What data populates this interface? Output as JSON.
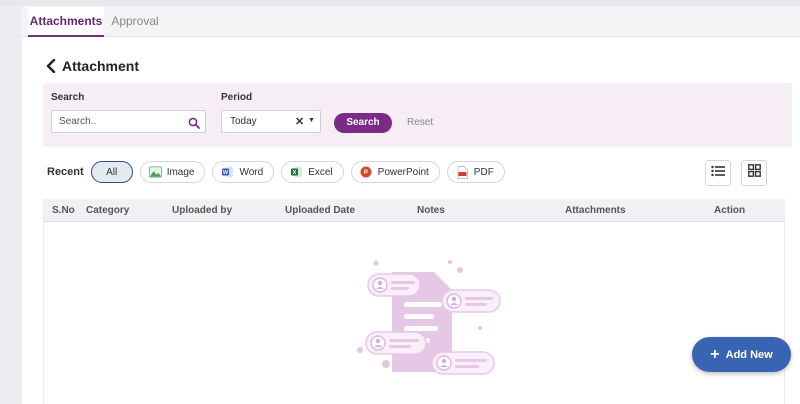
{
  "tabs": [
    {
      "label": "Attachments",
      "active": true
    },
    {
      "label": "Approval",
      "active": false
    }
  ],
  "page_title": "Attachment",
  "filters": {
    "search_label": "Search",
    "search_placeholder": "Search..",
    "period_label": "Period",
    "period_value": "Today",
    "search_button": "Search",
    "reset_button": "Reset"
  },
  "recent": {
    "label": "Recent",
    "chips": [
      {
        "label": "All",
        "icon": "none",
        "active": true
      },
      {
        "label": "Image",
        "icon": "image-icon",
        "active": false
      },
      {
        "label": "Word",
        "icon": "word-icon",
        "active": false
      },
      {
        "label": "Excel",
        "icon": "excel-icon",
        "active": false
      },
      {
        "label": "PowerPoint",
        "icon": "powerpoint-icon",
        "active": false
      },
      {
        "label": "PDF",
        "icon": "pdf-icon",
        "active": false
      }
    ]
  },
  "view_toggle": [
    "list-view-icon",
    "grid-view-icon"
  ],
  "table": {
    "columns": [
      "S.No",
      "Category",
      "Uploaded by",
      "Uploaded Date",
      "Notes",
      "Attachments",
      "Action"
    ],
    "rows": []
  },
  "add_button": "Add New",
  "colors": {
    "primary": "#7b2a86",
    "accent_blue": "#3963b3",
    "panel_bg": "#f6eef4"
  }
}
